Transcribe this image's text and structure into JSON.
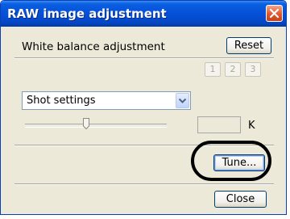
{
  "window": {
    "title": "RAW image adjustment"
  },
  "white_balance": {
    "section_label": "White balance adjustment",
    "reset_label": "Reset",
    "preset_buttons": [
      "1",
      "2",
      "3"
    ],
    "select_value": "Shot settings",
    "kelvin_value": "",
    "kelvin_unit": "K"
  },
  "buttons": {
    "tune_label": "Tune...",
    "close_label": "Close"
  }
}
